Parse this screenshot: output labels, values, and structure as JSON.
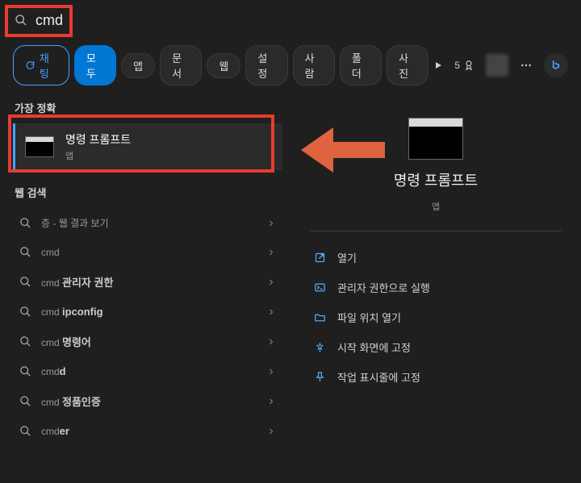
{
  "search": {
    "query": "cmd"
  },
  "tabs": {
    "chat": "채팅",
    "items": [
      "모두",
      "앱",
      "문서",
      "웹",
      "설정",
      "사람",
      "폴더",
      "사진"
    ],
    "rewards": "5"
  },
  "left": {
    "best_header": "가장 정확",
    "best": {
      "title": "명령 프롬프트",
      "sub": "앱"
    },
    "web_header": "웹 검색",
    "items": [
      {
        "prefix": "층",
        "suffix": " - 웹 결과 보기"
      },
      {
        "prefix": "cmd",
        "suffix": ""
      },
      {
        "prefix": "cmd ",
        "bold": "관리자 권한",
        "suffix": ""
      },
      {
        "prefix": "cmd ",
        "bold": "ipconfig",
        "suffix": ""
      },
      {
        "prefix": "cmd ",
        "bold": "명령어",
        "suffix": ""
      },
      {
        "prefix": "cmd",
        "bold": "d",
        "suffix": ""
      },
      {
        "prefix": "cmd ",
        "bold": "정품인증",
        "suffix": ""
      },
      {
        "prefix": "cmd",
        "bold": "er",
        "suffix": ""
      }
    ]
  },
  "detail": {
    "title": "명령 프롬프트",
    "sub": "앱",
    "actions": [
      {
        "icon": "open",
        "label": "열기"
      },
      {
        "icon": "admin",
        "label": "관리자 권한으로 실행"
      },
      {
        "icon": "folder",
        "label": "파일 위치 열기"
      },
      {
        "icon": "pin-start",
        "label": "시작 화면에 고정"
      },
      {
        "icon": "pin-task",
        "label": "작업 표시줄에 고정"
      }
    ]
  }
}
